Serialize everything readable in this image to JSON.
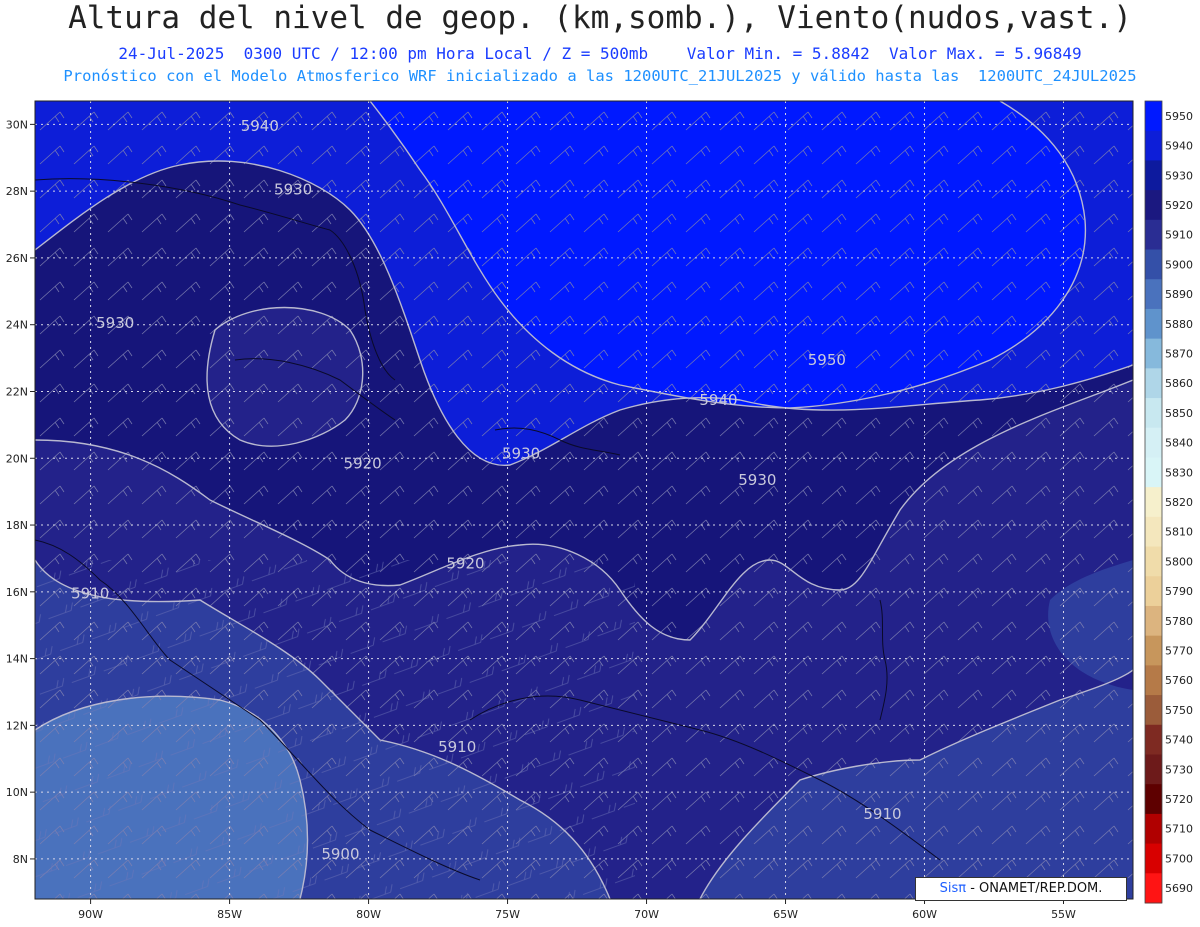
{
  "header": {
    "title": "Altura del nivel de geop. (km,somb.), Viento(nudos,vast.)",
    "line1": "24-Jul-2025  0300 UTC / 12:00 pm Hora Local / Z = 500mb    Valor Min. = 5.8842  Valor Max. = 5.96849",
    "line2": "Pronóstico con el Modelo Atmosferico WRF inicializado a las 1200UTC_21JUL2025 y válido hasta las  1200UTC_24JUL2025"
  },
  "credit": {
    "brand": "Sisπ",
    "text": " - ONAMET/REP.DOM."
  },
  "chart_data": {
    "type": "heatmap",
    "lon_ticks": [
      "90W",
      "85W",
      "80W",
      "75W",
      "70W",
      "65W",
      "60W",
      "55W"
    ],
    "lat_ticks": [
      "30N",
      "28N",
      "26N",
      "24N",
      "22N",
      "20N",
      "18N",
      "16N",
      "14N",
      "12N",
      "10N",
      "8N"
    ],
    "lon_range": [
      -92,
      -52.5
    ],
    "lat_range": [
      6.8,
      30.7
    ],
    "colorbar": {
      "levels": [
        5950,
        5940,
        5930,
        5920,
        5910,
        5900,
        5890,
        5880,
        5870,
        5860,
        5850,
        5840,
        5830,
        5820,
        5810,
        5800,
        5790,
        5780,
        5770,
        5760,
        5750,
        5740,
        5730,
        5720,
        5710,
        5700,
        5690
      ],
      "colors": [
        "#0019ff",
        "#0d1ed8",
        "#0d1a9e",
        "#1b1880",
        "#2a2d93",
        "#3450a8",
        "#4a72bd",
        "#5f93cc",
        "#86b9dc",
        "#afd6e8",
        "#c8e8f0",
        "#d5f0f5",
        "#d9f5f7",
        "#f6f0cc",
        "#f4e7bd",
        "#f0dcaa",
        "#ecd09a",
        "#dcb47f",
        "#c7965c",
        "#b57a48",
        "#9b5c3a",
        "#7e2a22",
        "#6d1a1a",
        "#5e0000",
        "#b00000",
        "#d80000",
        "#ff1414"
      ]
    },
    "contour_labels": [
      {
        "text": "5940",
        "lon": -84.6,
        "lat": 29.8
      },
      {
        "text": "5930",
        "lon": -83.4,
        "lat": 27.9
      },
      {
        "text": "5930",
        "lon": -89.8,
        "lat": 23.9
      },
      {
        "text": "5950",
        "lon": -64.2,
        "lat": 22.8
      },
      {
        "text": "5940",
        "lon": -68.1,
        "lat": 21.6
      },
      {
        "text": "5930",
        "lon": -75.2,
        "lat": 20.0
      },
      {
        "text": "5930",
        "lon": -66.7,
        "lat": 19.2
      },
      {
        "text": "5920",
        "lon": -80.9,
        "lat": 19.7
      },
      {
        "text": "5920",
        "lon": -77.2,
        "lat": 16.7
      },
      {
        "text": "5910",
        "lon": -90.7,
        "lat": 15.8
      },
      {
        "text": "5910",
        "lon": -77.5,
        "lat": 11.2
      },
      {
        "text": "5910",
        "lon": -62.2,
        "lat": 9.2
      },
      {
        "text": "5900",
        "lon": -81.7,
        "lat": 8.0
      }
    ]
  }
}
